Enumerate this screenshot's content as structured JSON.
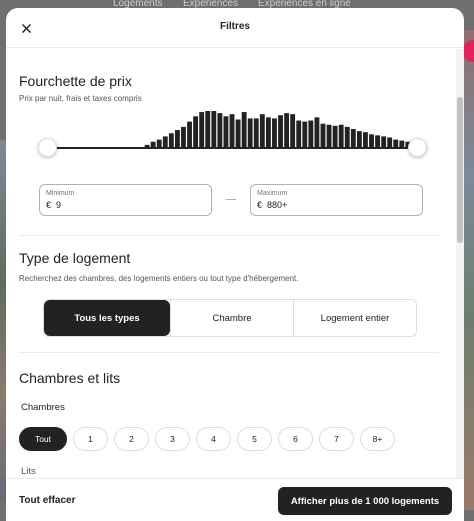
{
  "background": {
    "tabs": [
      "Logements",
      "Expériences",
      "Expériences en ligne"
    ]
  },
  "header": {
    "title": "Filtres",
    "close_icon": "close-icon"
  },
  "price": {
    "title": "Fourchette de prix",
    "subtitle": "Prix par nuit, frais et taxes compris",
    "histogram": [
      0,
      0,
      0,
      0,
      0,
      0,
      0,
      0,
      0,
      0,
      0,
      0,
      0,
      0,
      0,
      0,
      2,
      5,
      7,
      10,
      13,
      16,
      19,
      24,
      29,
      33,
      34,
      34,
      32,
      29,
      31,
      26,
      33,
      27,
      27,
      31,
      28,
      27,
      30,
      32,
      31,
      25,
      24,
      25,
      28,
      22,
      21,
      20,
      21,
      19,
      17,
      15,
      14,
      12,
      11,
      10,
      9,
      7,
      6,
      5,
      5
    ],
    "min_value": 0,
    "max_value": 1,
    "minimum_label": "Minimum",
    "minimum_currency": "€",
    "minimum_amount": "9",
    "maximum_label": "Maximum",
    "maximum_currency": "€",
    "maximum_amount": "880+"
  },
  "type": {
    "title": "Type de logement",
    "subtitle": "Recherchez des chambres, des logements entiers ou tout type d'hébergement.",
    "options": [
      "Tous les types",
      "Chambre",
      "Logement entier"
    ],
    "selected": "Tous les types"
  },
  "rooms": {
    "title": "Chambres et lits",
    "bedrooms_label": "Chambres",
    "options": [
      "Tout",
      "1",
      "2",
      "3",
      "4",
      "5",
      "6",
      "7",
      "8+"
    ],
    "selected": "Tout",
    "beds_label": "Lits"
  },
  "footer": {
    "clear_label": "Tout effacer",
    "cta_label": "Afficher plus de 1 000 logements"
  },
  "colors": {
    "primary": "#222222",
    "border": "#dddddd",
    "muted": "#717171"
  }
}
